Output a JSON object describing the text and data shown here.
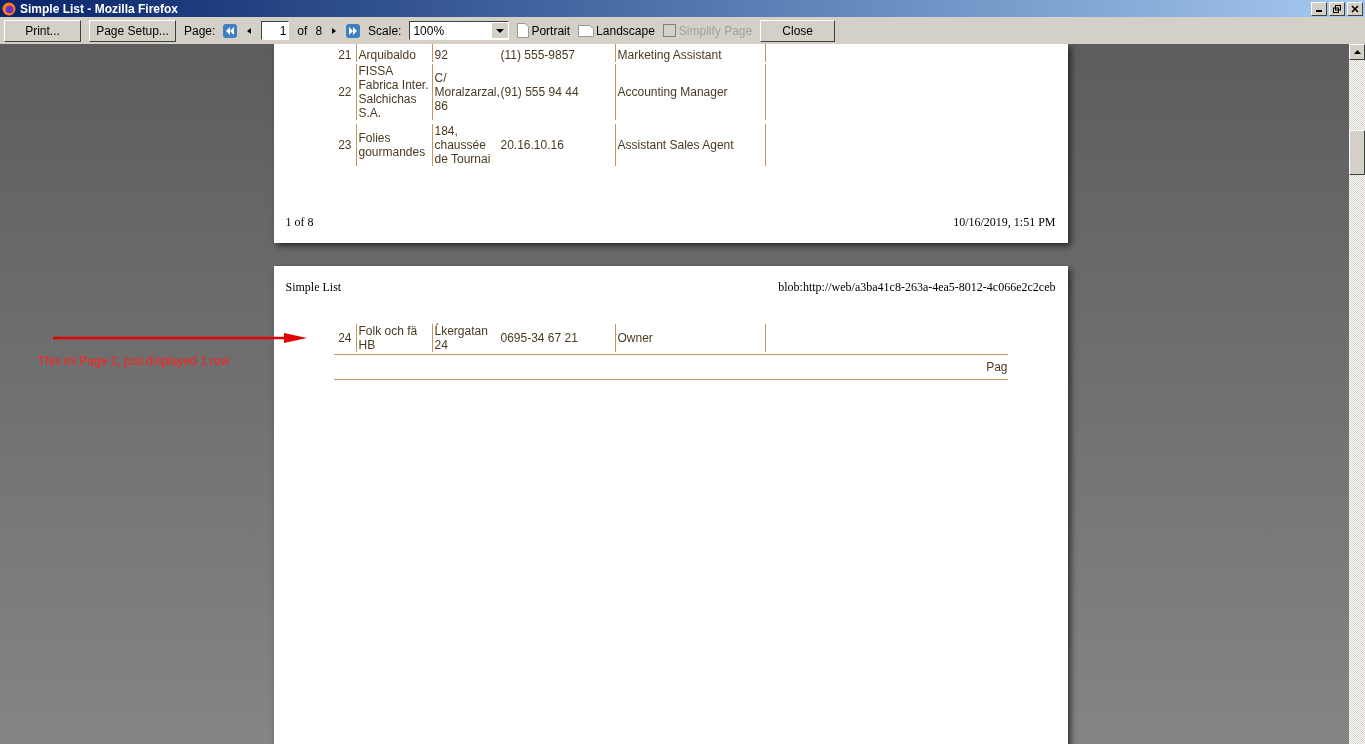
{
  "window": {
    "title": "Simple List - Mozilla Firefox"
  },
  "toolbar": {
    "print": "Print...",
    "page_setup": "Page Setup...",
    "page_label": "Page:",
    "page_value": "1",
    "of": "of",
    "page_count": "8",
    "scale_label": "Scale:",
    "scale_value": "100%",
    "portrait": "Portrait",
    "landscape": "Landscape",
    "simplify": {
      "label": "Simplify Page",
      "checked": false,
      "disabled": true
    },
    "close": "Close"
  },
  "pages": [
    {
      "rows": [
        {
          "number": "21",
          "company": "Arquibaldo",
          "address": "92",
          "phone": "(11) 555-9857",
          "title": "Marketing Assistant"
        },
        {
          "number": "22",
          "company": "FISSA Fabrica Inter. Salchichas S.A.",
          "address": "C/ Moralzarzal, 86",
          "phone": "(91) 555 94 44",
          "title": "Accounting Manager"
        },
        {
          "number": "23",
          "company": "Folies gourmandes",
          "address": "184, chaussée de Tournai",
          "phone": "20.16.10.16",
          "title": "Assistant Sales Agent"
        }
      ],
      "footer_left": "1 of 8",
      "footer_right": "10/16/2019, 1:51 PM"
    },
    {
      "header_left": "Simple List",
      "header_right": "blob:http://web/a3ba41c8-263a-4ea5-8012-4c066e2c2ceb",
      "rows": [
        {
          "number": "24",
          "company": "Folk och fä HB",
          "address": "Ĺkergatan 24",
          "phone": "0695-34 67 21",
          "title": "Owner"
        }
      ],
      "footer_text": "Pag"
    }
  ],
  "annotation": {
    "text": "This ini Page 2, just displayed 1 row"
  }
}
